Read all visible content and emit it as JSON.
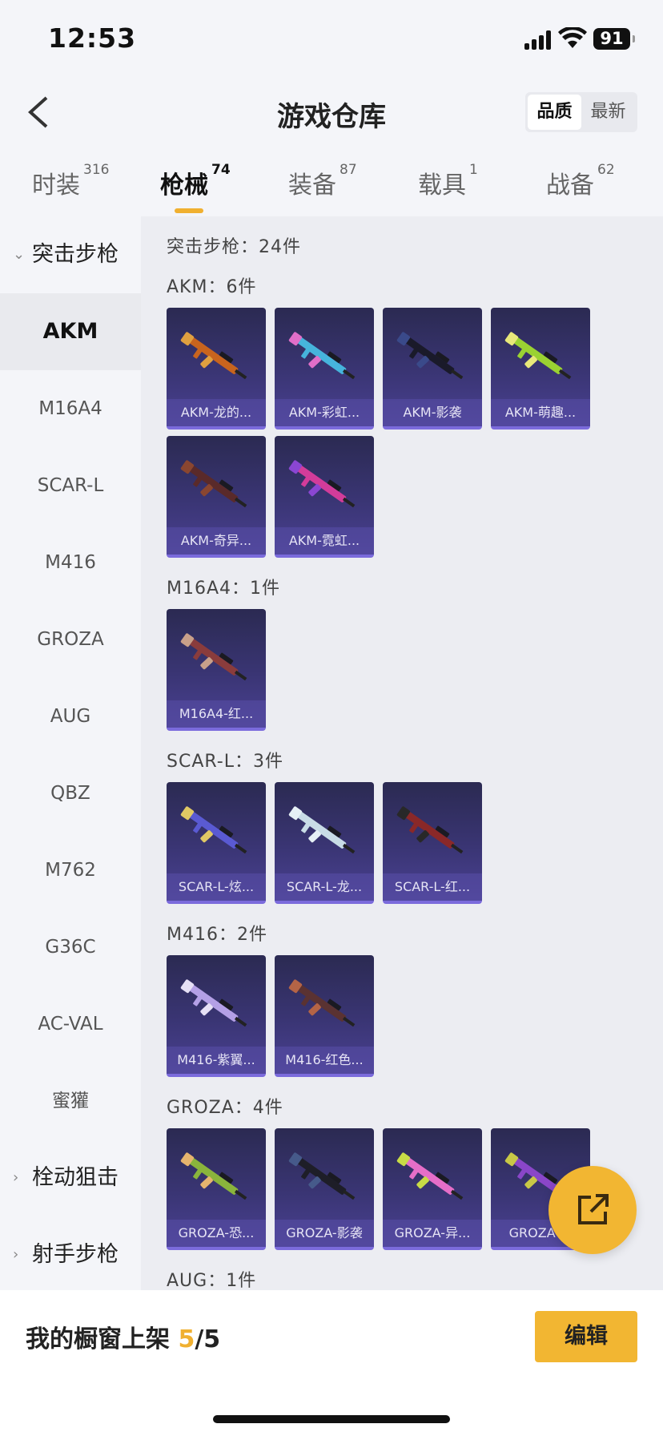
{
  "status_bar": {
    "time": "12:53",
    "battery": "91"
  },
  "header": {
    "title": "游戏仓库",
    "sort_options": [
      "品质",
      "最新"
    ],
    "active_sort": "品质"
  },
  "tabs": [
    {
      "label": "时装",
      "count": "316"
    },
    {
      "label": "枪械",
      "count": "74"
    },
    {
      "label": "装备",
      "count": "87"
    },
    {
      "label": "载具",
      "count": "1"
    },
    {
      "label": "战备",
      "count": "62"
    }
  ],
  "active_tab": "枪械",
  "sidebar": {
    "groups": [
      {
        "label": "突击步枪",
        "expanded": true
      },
      {
        "label": "栓动狙击",
        "expanded": false
      },
      {
        "label": "射手步枪",
        "expanded": false
      }
    ],
    "items": [
      "AKM",
      "M16A4",
      "SCAR-L",
      "M416",
      "GROZA",
      "AUG",
      "QBZ",
      "M762",
      "G36C",
      "AC-VAL",
      "蜜獾"
    ],
    "active_item": "AKM"
  },
  "content": {
    "category_summary": "突击步枪：24件",
    "sections": [
      {
        "title": "AKM：6件",
        "items": [
          {
            "name": "AKM-龙的...",
            "colors": [
              "#c8641e",
              "#e0a040"
            ]
          },
          {
            "name": "AKM-彩虹...",
            "colors": [
              "#46b4dc",
              "#e06ec8"
            ]
          },
          {
            "name": "AKM-影袭",
            "colors": [
              "#1a1a2a",
              "#3a4a8a"
            ]
          },
          {
            "name": "AKM-萌趣...",
            "colors": [
              "#9ad232",
              "#e8e87a"
            ]
          },
          {
            "name": "AKM-奇异...",
            "colors": [
              "#5a2a2a",
              "#8a4630"
            ]
          },
          {
            "name": "AKM-霓虹...",
            "colors": [
              "#d23c9a",
              "#8a46d2"
            ]
          }
        ]
      },
      {
        "title": "M16A4：1件",
        "items": [
          {
            "name": "M16A4-红...",
            "colors": [
              "#8a3c3c",
              "#c8a08a"
            ]
          }
        ]
      },
      {
        "title": "SCAR-L：3件",
        "items": [
          {
            "name": "SCAR-L-炫...",
            "colors": [
              "#5a5ad2",
              "#e0c864"
            ]
          },
          {
            "name": "SCAR-L-龙...",
            "colors": [
              "#c8dce6",
              "#e6f0f5"
            ]
          },
          {
            "name": "SCAR-L-红...",
            "colors": [
              "#8a2828",
              "#282828"
            ]
          }
        ]
      },
      {
        "title": "M416：2件",
        "items": [
          {
            "name": "M416-紫翼...",
            "colors": [
              "#b4a0e6",
              "#e6e0f5"
            ]
          },
          {
            "name": "M416-红色...",
            "colors": [
              "#5a3232",
              "#b46446"
            ]
          }
        ]
      },
      {
        "title": "GROZA：4件",
        "items": [
          {
            "name": "GROZA-恐...",
            "colors": [
              "#8ab43c",
              "#e6b46e"
            ]
          },
          {
            "name": "GROZA-影袭",
            "colors": [
              "#1e1e28",
              "#465a8a"
            ]
          },
          {
            "name": "GROZA-异...",
            "colors": [
              "#e66ec8",
              "#c8dc46"
            ]
          },
          {
            "name": "GROZA-...",
            "colors": [
              "#8a46c8",
              "#c8c846"
            ]
          }
        ]
      },
      {
        "title": "AUG：1件",
        "items": []
      }
    ]
  },
  "fab_icon": "share-external-icon",
  "bottom_bar": {
    "showcase_label": "我的橱窗上架",
    "showcase_current": "5",
    "showcase_total": "/5",
    "edit_label": "编辑"
  },
  "colors": {
    "accent": "#f2b632",
    "card_top": "#2b2a52",
    "card_bottom": "#4a4192"
  }
}
